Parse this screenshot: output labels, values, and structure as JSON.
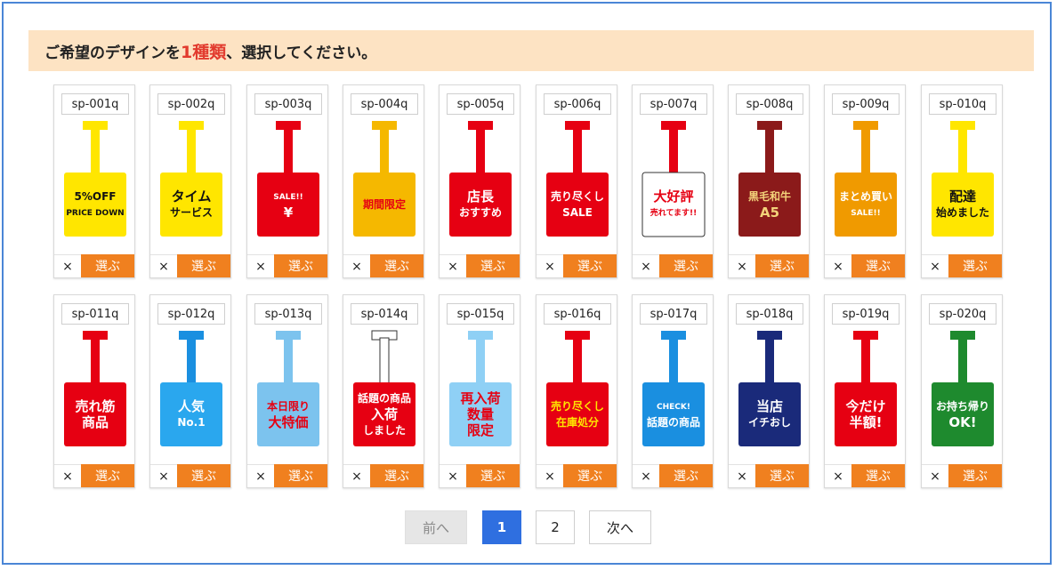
{
  "banner": {
    "text_before": "ご希望のデザインを",
    "highlight": "1種類",
    "text_after": "、選択してください。"
  },
  "remove_symbol": "×",
  "select_label": "選ぶ",
  "items": [
    {
      "code": "sp-001q",
      "pole": "#ffe600",
      "bg": "#ffe600",
      "fg": "#111111",
      "lines": [
        "5%OFF",
        "PRICE DOWN"
      ]
    },
    {
      "code": "sp-002q",
      "pole": "#ffe600",
      "bg": "#ffe600",
      "fg": "#111111",
      "lines": [
        "タイム",
        "サービス"
      ]
    },
    {
      "code": "sp-003q",
      "pole": "#e60012",
      "bg": "#e60012",
      "fg": "#ffffff",
      "lines": [
        "SALE!!",
        "¥"
      ]
    },
    {
      "code": "sp-004q",
      "pole": "#f5b800",
      "bg": "#f5b800",
      "fg": "#e60012",
      "lines": [
        "期間限定"
      ]
    },
    {
      "code": "sp-005q",
      "pole": "#e60012",
      "bg": "#e60012",
      "fg": "#ffffff",
      "lines": [
        "店長",
        "おすすめ"
      ]
    },
    {
      "code": "sp-006q",
      "pole": "#e60012",
      "bg": "#e60012",
      "fg": "#ffffff",
      "lines": [
        "売り尽くし",
        "SALE"
      ]
    },
    {
      "code": "sp-007q",
      "pole": "#e60012",
      "bg": "#ffffff",
      "fg": "#e60012",
      "lines": [
        "大好評",
        "売れてます!!"
      ]
    },
    {
      "code": "sp-008q",
      "pole": "#8b1a1a",
      "bg": "#8b1a1a",
      "fg": "#f3d27a",
      "lines": [
        "黒毛和牛",
        "A5"
      ]
    },
    {
      "code": "sp-009q",
      "pole": "#f09a00",
      "bg": "#f09a00",
      "fg": "#ffffff",
      "lines": [
        "まとめ買い",
        "SALE!!"
      ]
    },
    {
      "code": "sp-010q",
      "pole": "#ffe600",
      "bg": "#ffe600",
      "fg": "#111111",
      "lines": [
        "配達",
        "始めました"
      ]
    },
    {
      "code": "sp-011q",
      "pole": "#e60012",
      "bg": "#e60012",
      "fg": "#ffffff",
      "lines": [
        "売れ筋",
        "商品"
      ]
    },
    {
      "code": "sp-012q",
      "pole": "#1a8fe0",
      "bg": "#2aa7ee",
      "fg": "#ffffff",
      "lines": [
        "人気",
        "No.1"
      ]
    },
    {
      "code": "sp-013q",
      "pole": "#7cc3ee",
      "bg": "#7cc3ee",
      "fg": "#e60012",
      "lines": [
        "本日限り",
        "大特価"
      ]
    },
    {
      "code": "sp-014q",
      "pole": "#ffffff",
      "bg": "#e60012",
      "fg": "#ffffff",
      "lines": [
        "話題の商品",
        "入荷",
        "しました"
      ]
    },
    {
      "code": "sp-015q",
      "pole": "#8fd0f5",
      "bg": "#8fd0f5",
      "fg": "#e60012",
      "lines": [
        "再入荷",
        "数量",
        "限定"
      ]
    },
    {
      "code": "sp-016q",
      "pole": "#e60012",
      "bg": "#e60012",
      "fg": "#ffe600",
      "lines": [
        "売り尽くし",
        "在庫処分"
      ]
    },
    {
      "code": "sp-017q",
      "pole": "#1a8fe0",
      "bg": "#1a8fe0",
      "fg": "#ffffff",
      "lines": [
        "CHECK!",
        "話題の商品"
      ]
    },
    {
      "code": "sp-018q",
      "pole": "#1a2a7a",
      "bg": "#1a2a7a",
      "fg": "#ffffff",
      "lines": [
        "当店",
        "イチおし"
      ]
    },
    {
      "code": "sp-019q",
      "pole": "#e60012",
      "bg": "#e60012",
      "fg": "#ffffff",
      "lines": [
        "今だけ",
        "半額!"
      ]
    },
    {
      "code": "sp-020q",
      "pole": "#1e8a2e",
      "bg": "#1e8a2e",
      "fg": "#ffffff",
      "lines": [
        "お持ち帰り",
        "OK!"
      ]
    }
  ],
  "pagination": {
    "prev": "前へ",
    "pages": [
      "1",
      "2"
    ],
    "next": "次へ"
  }
}
